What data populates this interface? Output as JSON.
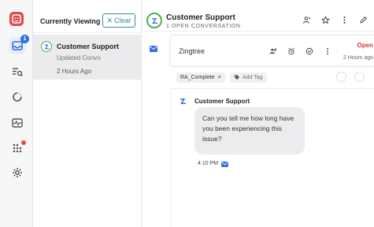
{
  "rail": {
    "icons": [
      "logo-icon",
      "inbox-icon",
      "search-list-icon",
      "reports-icon",
      "activity-icon",
      "apps-grid-icon",
      "settings-icon"
    ],
    "inbox_badge": "1"
  },
  "list": {
    "title": "Currently Viewing",
    "clear_label": "Clear",
    "items": [
      {
        "name": "Customer Support",
        "subtitle": "Updated Convo",
        "time": "2 Hours Ago"
      }
    ]
  },
  "header": {
    "title": "Customer Support",
    "subtitle": "1 OPEN CONVERSATION"
  },
  "ticket": {
    "name": "Zingtree",
    "status": "Open",
    "time": "2 Hours ago"
  },
  "tags": {
    "items": [
      "RA_Complete"
    ],
    "add_label": "Add Tag"
  },
  "message": {
    "sender": "Customer Support",
    "body": "Can you tell me how long have you been experiencing this issue?",
    "time": "4:10 PM"
  },
  "colors": {
    "accent": "#2f8f9d",
    "brand_blue": "#2f6fe4",
    "status_open": "#d43c3c",
    "online_green": "#4caf50"
  }
}
